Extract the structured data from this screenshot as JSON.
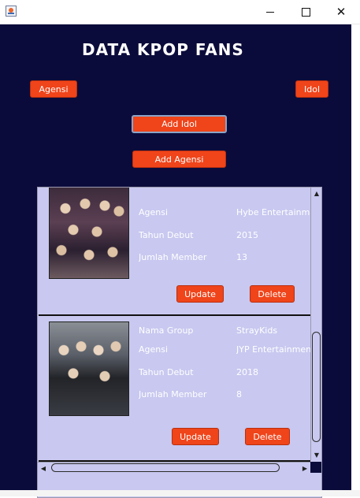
{
  "titlebar": {
    "icon": "java-cup-icon",
    "minimize_glyph": "",
    "close_glyph": "✕"
  },
  "header": {
    "title": "DATA KPOP FANS"
  },
  "nav": {
    "agensi_label": "Agensi",
    "idol_label": "Idol",
    "add_idol_label": "Add Idol",
    "add_agensi_label": "Add Agensi"
  },
  "cards": [
    {
      "fields": [
        {
          "label": "Agensi",
          "value": "Hybe Entertainment"
        },
        {
          "label": "Tahun Debut",
          "value": "2015"
        },
        {
          "label": "Jumlah Member",
          "value": "13"
        }
      ],
      "update_label": "Update",
      "delete_label": "Delete"
    },
    {
      "fields": [
        {
          "label": "Nama Group",
          "value": "StrayKids"
        },
        {
          "label": "Agensi",
          "value": "JYP Entertainment"
        },
        {
          "label": "Tahun Debut",
          "value": "2018"
        },
        {
          "label": "Jumlah Member",
          "value": "8"
        }
      ],
      "update_label": "Update",
      "delete_label": "Delete"
    }
  ],
  "colors": {
    "background": "#0b0b3b",
    "button": "#f0441a",
    "panel": "#c8c8f0"
  }
}
